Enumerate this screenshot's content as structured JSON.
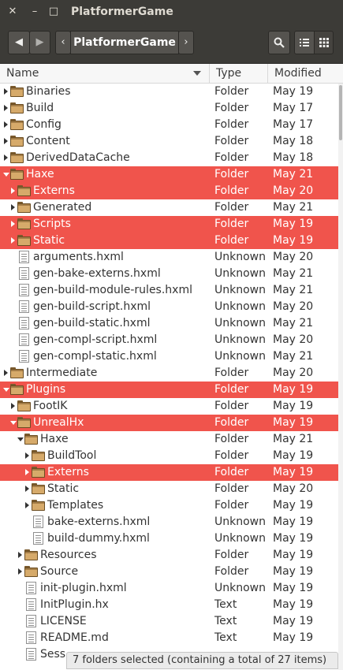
{
  "window": {
    "title": "PlatformerGame",
    "close_glyph": "✕",
    "minimize_glyph": "–",
    "maximize_glyph": "□"
  },
  "toolbar": {
    "back_glyph": "◀",
    "forward_glyph": "▶",
    "path_prev_glyph": "‹",
    "path_label": "PlatformerGame",
    "path_next_glyph": "›",
    "search_icon": "search-icon",
    "list_view_icon": "list-view-icon",
    "grid_view_icon": "grid-view-icon"
  },
  "columns": {
    "name": "Name",
    "type": "Type",
    "modified": "Modified"
  },
  "colors": {
    "selection": "#f0544c",
    "chrome": "#3c3b37",
    "folder": "#d6aa6a"
  },
  "rows": [
    {
      "name": "Binaries",
      "type": "Folder",
      "modified": "May 19",
      "depth": 0,
      "kind": "folder",
      "expander": "closed",
      "selected": false
    },
    {
      "name": "Build",
      "type": "Folder",
      "modified": "May 17",
      "depth": 0,
      "kind": "folder",
      "expander": "closed",
      "selected": false
    },
    {
      "name": "Config",
      "type": "Folder",
      "modified": "May 17",
      "depth": 0,
      "kind": "folder",
      "expander": "closed",
      "selected": false
    },
    {
      "name": "Content",
      "type": "Folder",
      "modified": "May 18",
      "depth": 0,
      "kind": "folder",
      "expander": "closed",
      "selected": false
    },
    {
      "name": "DerivedDataCache",
      "type": "Folder",
      "modified": "May 18",
      "depth": 0,
      "kind": "folder",
      "expander": "closed",
      "selected": false
    },
    {
      "name": "Haxe",
      "type": "Folder",
      "modified": "May 21",
      "depth": 0,
      "kind": "folder",
      "expander": "open",
      "selected": true
    },
    {
      "name": "Externs",
      "type": "Folder",
      "modified": "May 20",
      "depth": 1,
      "kind": "folder",
      "expander": "closed",
      "selected": true
    },
    {
      "name": "Generated",
      "type": "Folder",
      "modified": "May 21",
      "depth": 1,
      "kind": "folder",
      "expander": "closed",
      "selected": false
    },
    {
      "name": "Scripts",
      "type": "Folder",
      "modified": "May 19",
      "depth": 1,
      "kind": "folder",
      "expander": "closed",
      "selected": true
    },
    {
      "name": "Static",
      "type": "Folder",
      "modified": "May 19",
      "depth": 1,
      "kind": "folder",
      "expander": "closed",
      "selected": true
    },
    {
      "name": "arguments.hxml",
      "type": "Unknown",
      "modified": "May 20",
      "depth": 1,
      "kind": "file",
      "expander": "none",
      "selected": false
    },
    {
      "name": "gen-bake-externs.hxml",
      "type": "Unknown",
      "modified": "May 21",
      "depth": 1,
      "kind": "file",
      "expander": "none",
      "selected": false
    },
    {
      "name": "gen-build-module-rules.hxml",
      "type": "Unknown",
      "modified": "May 21",
      "depth": 1,
      "kind": "file",
      "expander": "none",
      "selected": false
    },
    {
      "name": "gen-build-script.hxml",
      "type": "Unknown",
      "modified": "May 20",
      "depth": 1,
      "kind": "file",
      "expander": "none",
      "selected": false
    },
    {
      "name": "gen-build-static.hxml",
      "type": "Unknown",
      "modified": "May 21",
      "depth": 1,
      "kind": "file",
      "expander": "none",
      "selected": false
    },
    {
      "name": "gen-compl-script.hxml",
      "type": "Unknown",
      "modified": "May 20",
      "depth": 1,
      "kind": "file",
      "expander": "none",
      "selected": false
    },
    {
      "name": "gen-compl-static.hxml",
      "type": "Unknown",
      "modified": "May 21",
      "depth": 1,
      "kind": "file",
      "expander": "none",
      "selected": false
    },
    {
      "name": "Intermediate",
      "type": "Folder",
      "modified": "May 20",
      "depth": 0,
      "kind": "folder",
      "expander": "closed",
      "selected": false
    },
    {
      "name": "Plugins",
      "type": "Folder",
      "modified": "May 19",
      "depth": 0,
      "kind": "folder",
      "expander": "open",
      "selected": true
    },
    {
      "name": "FootIK",
      "type": "Folder",
      "modified": "May 19",
      "depth": 1,
      "kind": "folder",
      "expander": "closed",
      "selected": false
    },
    {
      "name": "UnrealHx",
      "type": "Folder",
      "modified": "May 19",
      "depth": 1,
      "kind": "folder",
      "expander": "open",
      "selected": true
    },
    {
      "name": "Haxe",
      "type": "Folder",
      "modified": "May 21",
      "depth": 2,
      "kind": "folder",
      "expander": "open",
      "selected": false
    },
    {
      "name": "BuildTool",
      "type": "Folder",
      "modified": "May 19",
      "depth": 3,
      "kind": "folder",
      "expander": "closed",
      "selected": false
    },
    {
      "name": "Externs",
      "type": "Folder",
      "modified": "May 19",
      "depth": 3,
      "kind": "folder",
      "expander": "closed",
      "selected": true
    },
    {
      "name": "Static",
      "type": "Folder",
      "modified": "May 20",
      "depth": 3,
      "kind": "folder",
      "expander": "closed",
      "selected": false
    },
    {
      "name": "Templates",
      "type": "Folder",
      "modified": "May 19",
      "depth": 3,
      "kind": "folder",
      "expander": "closed",
      "selected": false
    },
    {
      "name": "bake-externs.hxml",
      "type": "Unknown",
      "modified": "May 19",
      "depth": 3,
      "kind": "file",
      "expander": "none",
      "selected": false
    },
    {
      "name": "build-dummy.hxml",
      "type": "Unknown",
      "modified": "May 19",
      "depth": 3,
      "kind": "file",
      "expander": "none",
      "selected": false
    },
    {
      "name": "Resources",
      "type": "Folder",
      "modified": "May 19",
      "depth": 2,
      "kind": "folder",
      "expander": "closed",
      "selected": false
    },
    {
      "name": "Source",
      "type": "Folder",
      "modified": "May 19",
      "depth": 2,
      "kind": "folder",
      "expander": "closed",
      "selected": false
    },
    {
      "name": "init-plugin.hxml",
      "type": "Unknown",
      "modified": "May 19",
      "depth": 2,
      "kind": "file",
      "expander": "none",
      "selected": false
    },
    {
      "name": "InitPlugin.hx",
      "type": "Text",
      "modified": "May 19",
      "depth": 2,
      "kind": "file",
      "expander": "none",
      "selected": false
    },
    {
      "name": "LICENSE",
      "type": "Text",
      "modified": "May 19",
      "depth": 2,
      "kind": "file",
      "expander": "none",
      "selected": false
    },
    {
      "name": "README.md",
      "type": "Text",
      "modified": "May 19",
      "depth": 2,
      "kind": "file",
      "expander": "none",
      "selected": false
    },
    {
      "name": "Sess",
      "type": "",
      "modified": "",
      "depth": 2,
      "kind": "file",
      "expander": "none",
      "selected": false
    }
  ],
  "status": {
    "text": "7 folders selected  (containing a total of 27 items)"
  }
}
